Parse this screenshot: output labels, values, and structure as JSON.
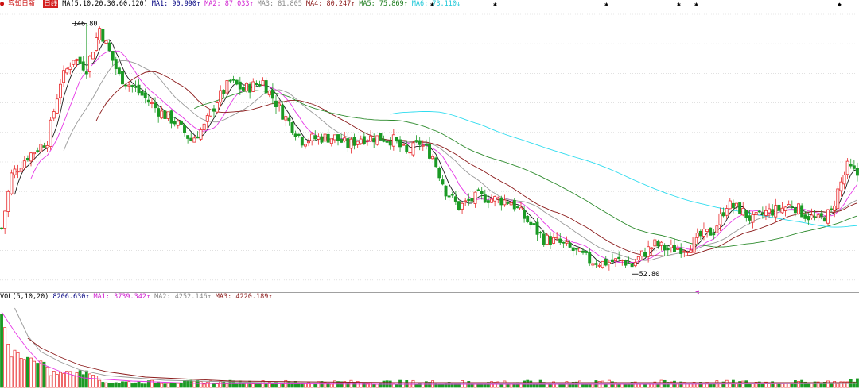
{
  "price_header": {
    "name_tag": "容知日新",
    "period_tag": "日线",
    "ma_title": "MA(5,10,20,30,60,120)",
    "ma1": "MA1: 90.990↑",
    "ma2": "MA2: 87.033↑",
    "ma3": "MA3: 81.805",
    "ma4": "MA4: 80.247↑",
    "ma5": "MA5: 75.869↑",
    "ma6": "MA6: 73.110↓"
  },
  "vol_header": {
    "title": "VOL(5,10,20)",
    "vol": "8206.630↑",
    "ma1": "MA1: 3739.342↑",
    "ma2": "MA2: 4252.146↑",
    "ma3": "MA3: 4220.189↑"
  },
  "annotations": {
    "high": "146.80",
    "low": "52.80"
  },
  "colors": {
    "up": "#e8282a",
    "down": "#1a9a24",
    "ma1": "#1a1a1a",
    "ma2": "#e637e6",
    "ma3": "#999999",
    "ma4": "#8b1a1a",
    "ma5": "#2e8b2e",
    "ma6": "#2fdcef",
    "grid": "#cfcfcf",
    "separator": "#a0a0a0"
  },
  "chart_data": {
    "type": "candlestick",
    "y_range": [
      49,
      152
    ],
    "anchors": [
      [
        0,
        70
      ],
      [
        3,
        90
      ],
      [
        8,
        97
      ],
      [
        14,
        103
      ],
      [
        18,
        125
      ],
      [
        22,
        134
      ],
      [
        26,
        130
      ],
      [
        30,
        145
      ],
      [
        36,
        127
      ],
      [
        42,
        121
      ],
      [
        48,
        114
      ],
      [
        53,
        110
      ],
      [
        58,
        103
      ],
      [
        62,
        108
      ],
      [
        66,
        118
      ],
      [
        70,
        125
      ],
      [
        74,
        122
      ],
      [
        80,
        125
      ],
      [
        86,
        113
      ],
      [
        92,
        103
      ],
      [
        98,
        104
      ],
      [
        102,
        104
      ],
      [
        106,
        101
      ],
      [
        110,
        104
      ],
      [
        116,
        104
      ],
      [
        120,
        103
      ],
      [
        124,
        98
      ],
      [
        128,
        102
      ],
      [
        132,
        97
      ],
      [
        136,
        84
      ],
      [
        140,
        78
      ],
      [
        146,
        82
      ],
      [
        150,
        81
      ],
      [
        156,
        80
      ],
      [
        160,
        74
      ],
      [
        166,
        66
      ],
      [
        170,
        65
      ],
      [
        176,
        61
      ],
      [
        180,
        58
      ],
      [
        184,
        57
      ],
      [
        190,
        58
      ],
      [
        193,
        56
      ],
      [
        196,
        60
      ],
      [
        200,
        64
      ],
      [
        204,
        62
      ],
      [
        210,
        63
      ],
      [
        214,
        67
      ],
      [
        218,
        69
      ],
      [
        222,
        79
      ],
      [
        226,
        77
      ],
      [
        230,
        73
      ],
      [
        234,
        76
      ],
      [
        238,
        77
      ],
      [
        242,
        79
      ],
      [
        246,
        75
      ],
      [
        250,
        73
      ],
      [
        254,
        76
      ],
      [
        256,
        84
      ],
      [
        259,
        93
      ],
      [
        262,
        90
      ]
    ],
    "high_annotation_index": 26,
    "low_annotation_index": 193,
    "volume_lines": {
      "ma1_points": [
        [
          0,
          95
        ],
        [
          4,
          70
        ],
        [
          8,
          48
        ],
        [
          12,
          30
        ],
        [
          18,
          20
        ],
        [
          25,
          12
        ],
        [
          40,
          8
        ],
        [
          60,
          5
        ],
        [
          120,
          4
        ],
        [
          200,
          4
        ],
        [
          262,
          5
        ]
      ],
      "ma2_points": [
        [
          4,
          100
        ],
        [
          8,
          65
        ],
        [
          12,
          45
        ],
        [
          18,
          32
        ],
        [
          24,
          22
        ],
        [
          32,
          15
        ],
        [
          50,
          9
        ],
        [
          80,
          6
        ],
        [
          150,
          5
        ],
        [
          262,
          5
        ]
      ],
      "ma3_points": [
        [
          8,
          62
        ],
        [
          12,
          50
        ],
        [
          18,
          38
        ],
        [
          24,
          28
        ],
        [
          32,
          20
        ],
        [
          44,
          13
        ],
        [
          70,
          8
        ],
        [
          120,
          6
        ],
        [
          262,
          6
        ]
      ]
    }
  }
}
